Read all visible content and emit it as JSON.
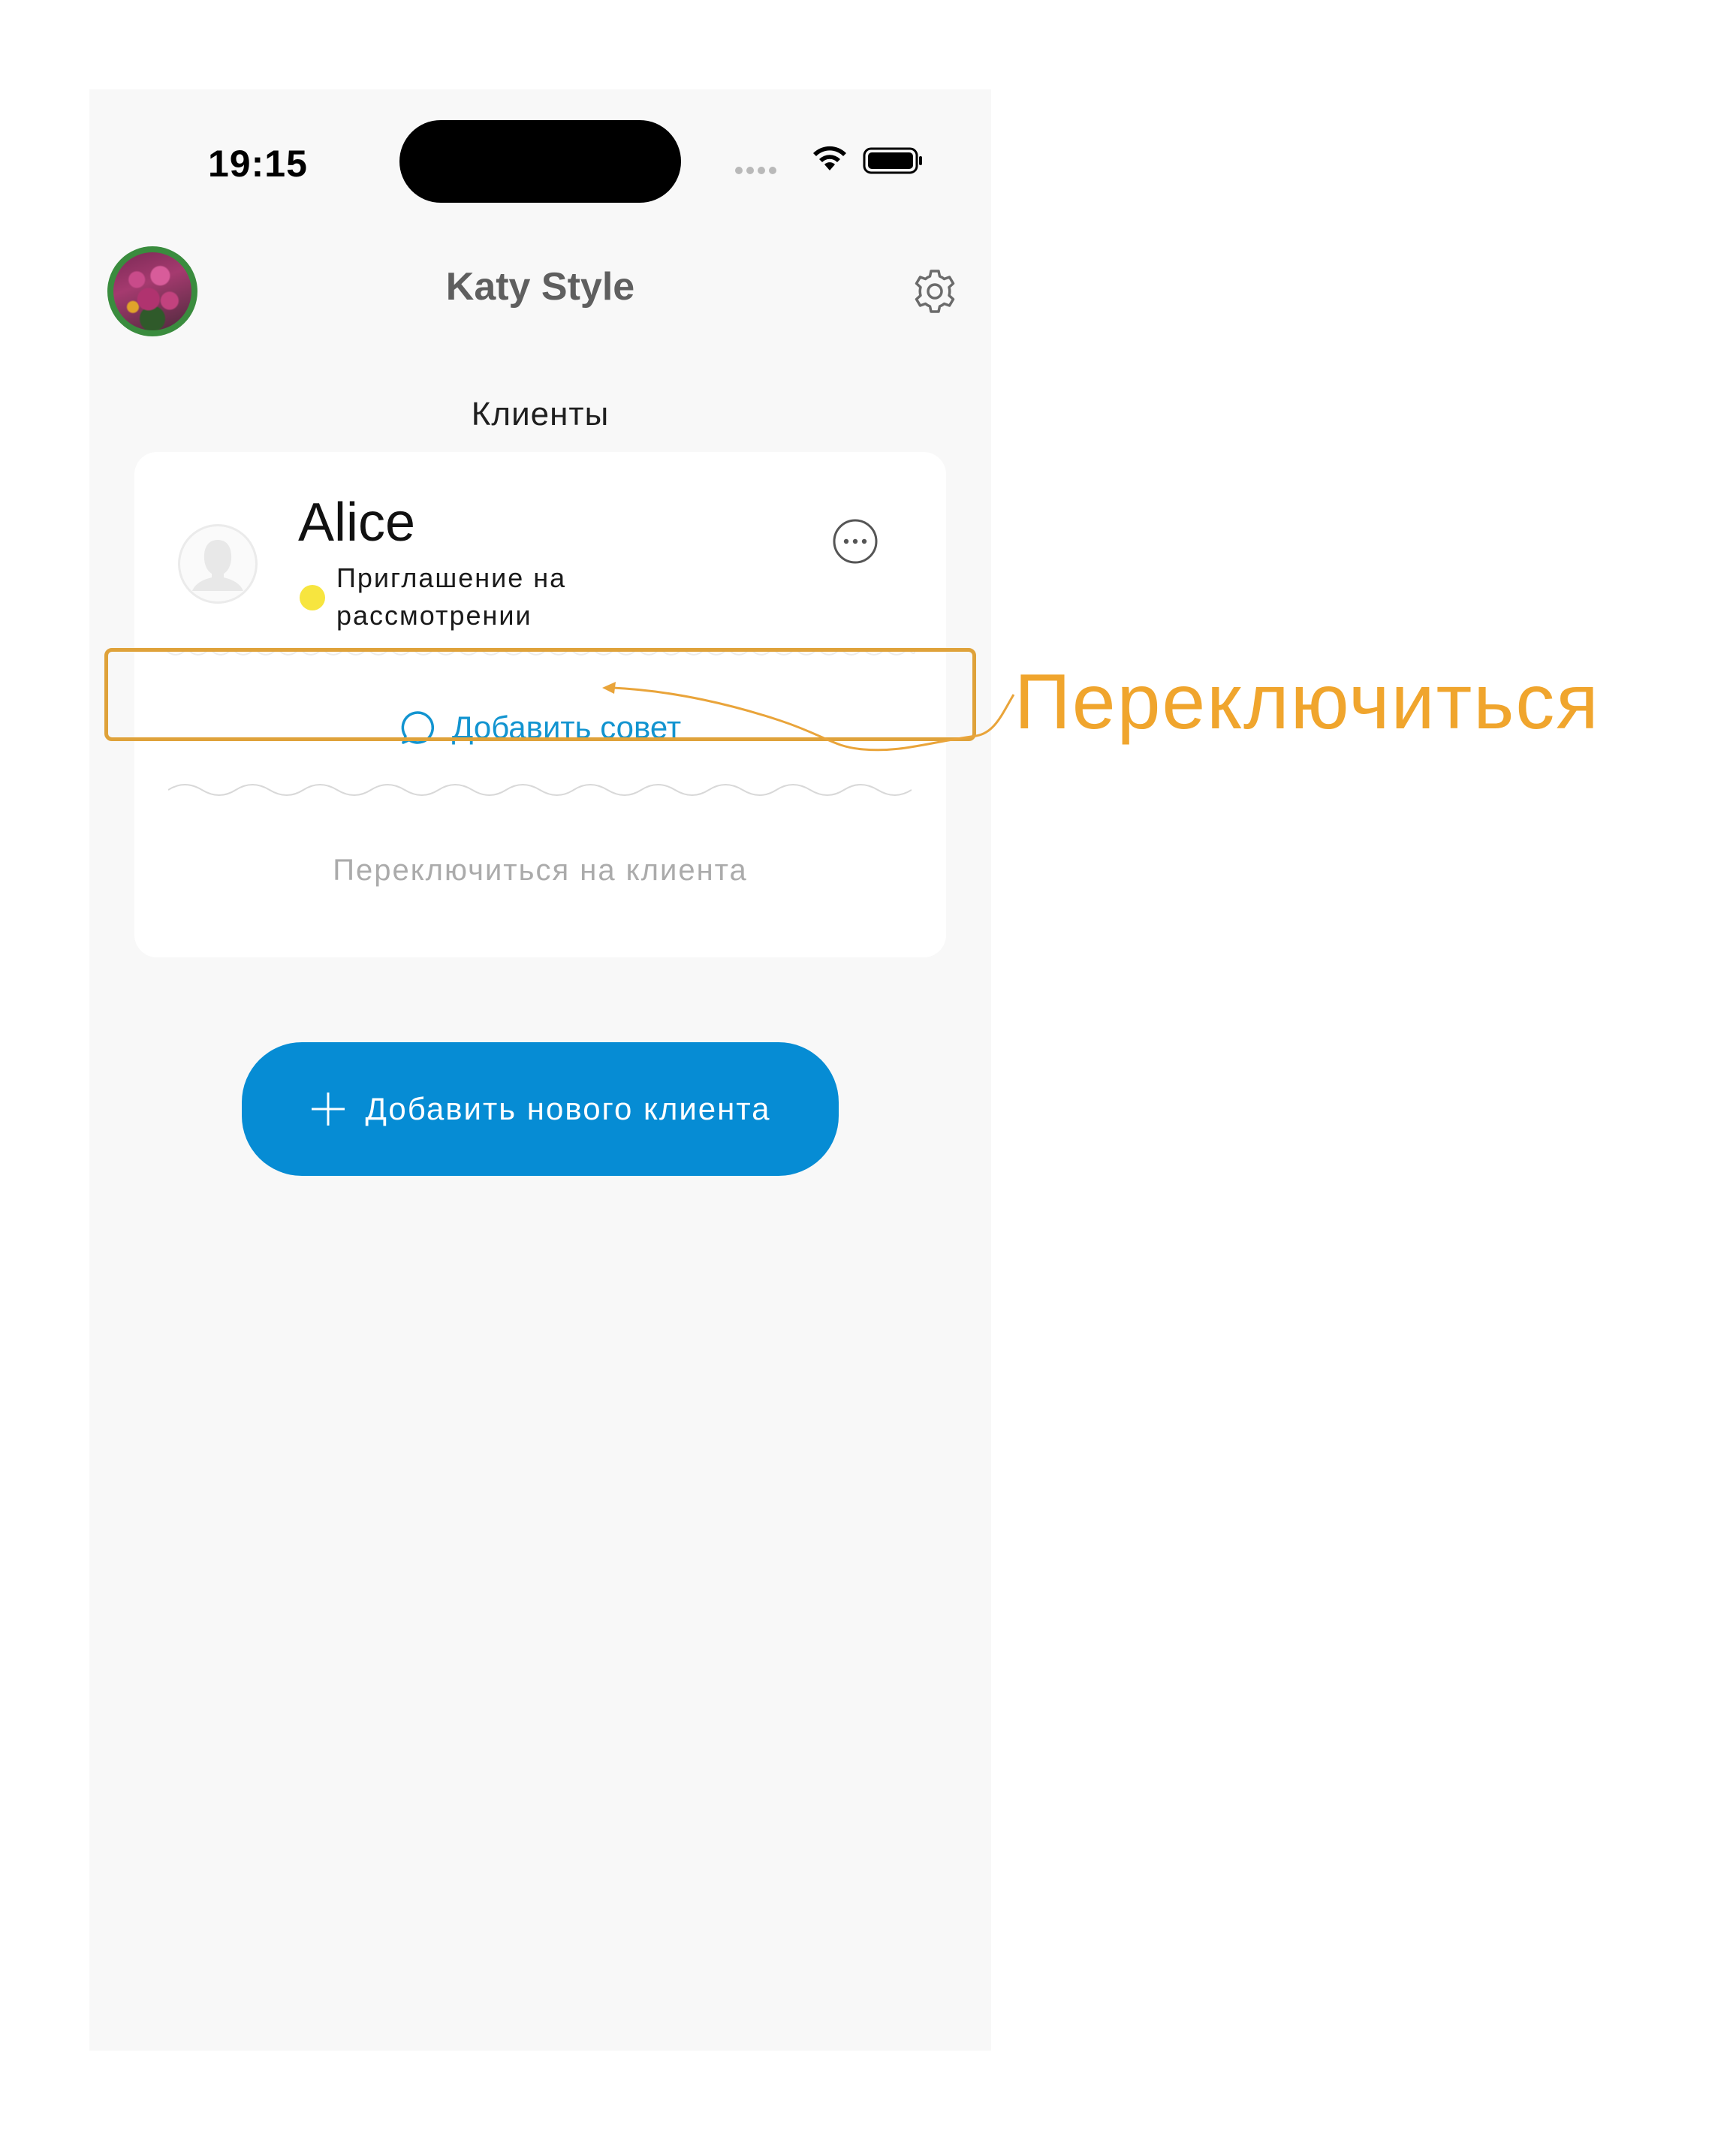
{
  "status_bar": {
    "time": "19:15"
  },
  "header": {
    "app_title": "Katy Style",
    "avatar_icon": "profile-photo",
    "settings_icon": "gear-icon"
  },
  "section": {
    "title": "Клиенты"
  },
  "client_card": {
    "name": "Alice",
    "status_color": "#f7e53f",
    "status_text": "Приглашение на рассмотрении",
    "add_tip_label": "Добавить совет",
    "switch_label": "Переключиться на клиента"
  },
  "actions": {
    "add_client_label": "Добавить нового клиента",
    "accent_color": "#068cd4"
  },
  "annotation": {
    "label": "Переключиться",
    "color": "#f0a52d"
  }
}
